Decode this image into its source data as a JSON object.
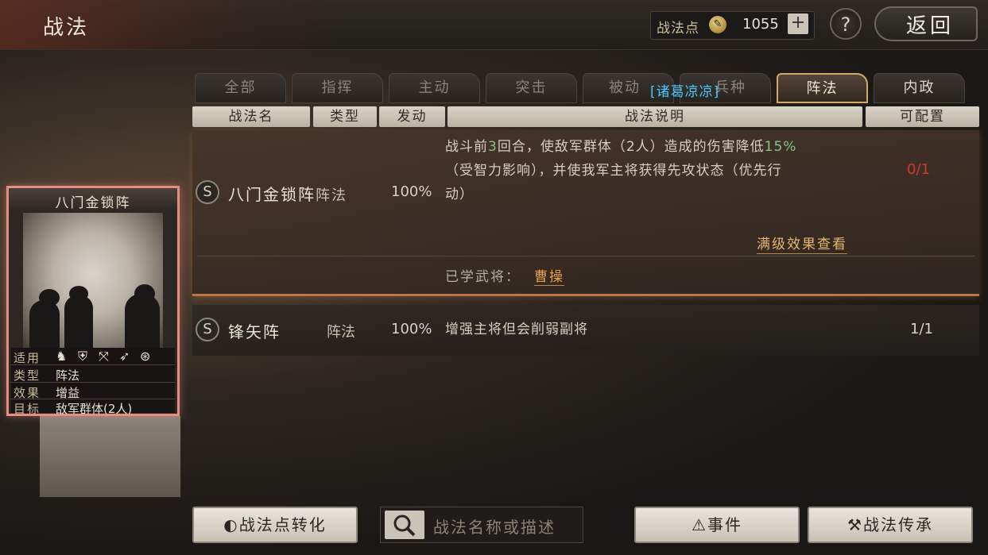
{
  "header": {
    "title": "战法",
    "points_label": "战法点",
    "points_value": "1055",
    "plus_label": "+",
    "help_label": "?",
    "back_label": "返回"
  },
  "tabs": [
    {
      "label": "全部"
    },
    {
      "label": "指挥"
    },
    {
      "label": "主动"
    },
    {
      "label": "突击"
    },
    {
      "label": "被动"
    },
    {
      "label": "兵种"
    },
    {
      "label": "阵法"
    },
    {
      "label": "内政"
    }
  ],
  "tooltip_tag": "[诸葛凉凉]",
  "columns": [
    "战法名",
    "类型",
    "发动",
    "战法说明",
    "可配置"
  ],
  "skills": [
    {
      "grade": "S",
      "name": "八门金锁阵",
      "type": "阵法",
      "rate": "100%",
      "desc_line1_a": "战斗前",
      "desc_line1_num": "3",
      "desc_line1_b": "回合，使敌军群体（2人）造成的伤害降低",
      "desc_line1_pct": "15%",
      "desc_line2": "（受智力影响），并使我军主将获得先攻状态（优先行",
      "desc_line3": "动）",
      "config": "0/1",
      "full_effect_link": "满级效果查看",
      "learned_label": "已学武将：",
      "learned_general": "曹操"
    },
    {
      "grade": "S",
      "name": "锋矢阵",
      "type": "阵法",
      "rate": "100%",
      "desc": "增强主将但会削弱副将",
      "config": "1/1"
    }
  ],
  "card": {
    "title": "八门金锁阵",
    "applicable_label": "适用",
    "troop_icons": [
      "cavalry-icon",
      "shield-icon",
      "bow-icon",
      "spear-icon",
      "wheel-icon"
    ],
    "type_label": "类型",
    "type_value": "阵法",
    "effect_label": "效果",
    "effect_value": "增益",
    "target_label": "目标",
    "target_value": "敌军群体(2人)"
  },
  "bottom": {
    "convert_label": "战法点转化",
    "search_placeholder": "战法名称或描述",
    "event_label": "事件",
    "inherit_label": "战法传承"
  },
  "colors": {
    "accent": "#d7a86b",
    "highlight": "#7fc68a",
    "warning": "#d23a2a",
    "link": "#e3b86f",
    "tag": "#4cc7ff"
  }
}
